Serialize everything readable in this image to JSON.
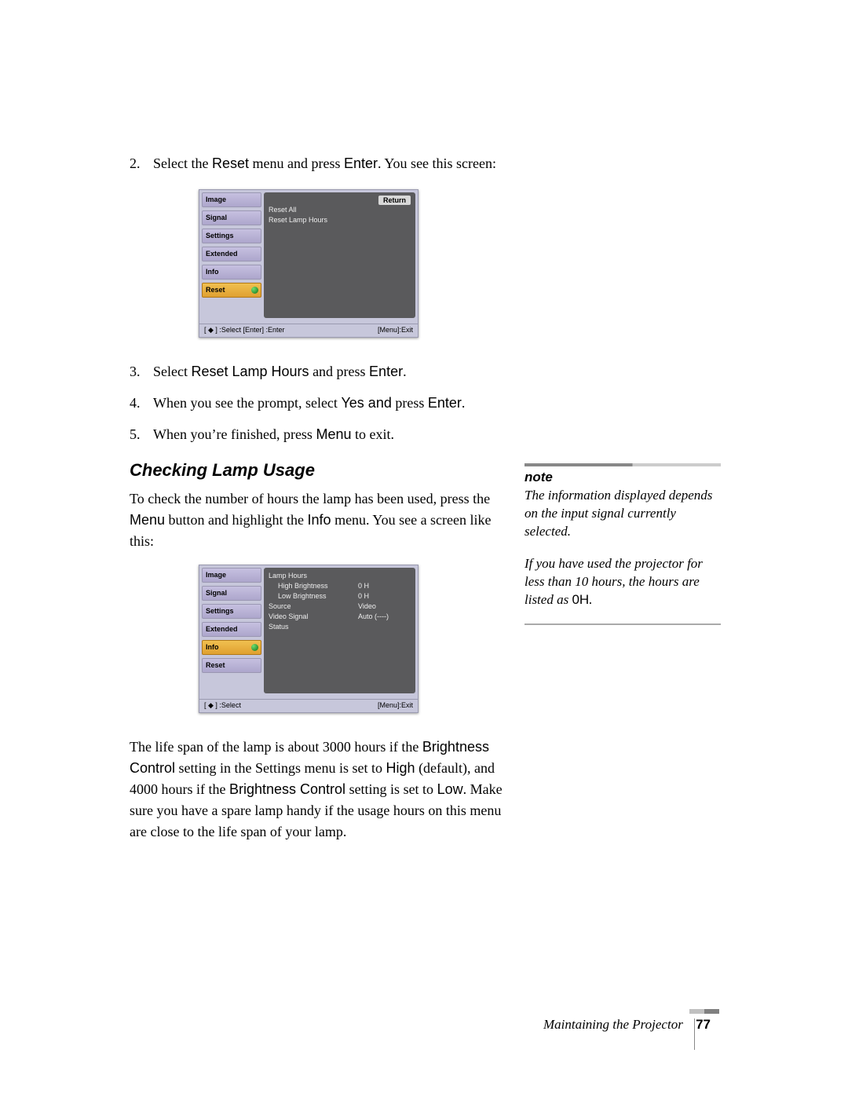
{
  "steps_top": [
    {
      "n": "2.",
      "pre": "Select the ",
      "b1": "Reset",
      "mid": " menu and press ",
      "b2": "Enter",
      "post": ". You see this screen:"
    }
  ],
  "osd1": {
    "tabs": [
      "Image",
      "Signal",
      "Settings",
      "Extended",
      "Info",
      "Reset"
    ],
    "selected_index": 5,
    "return": "Return",
    "items": [
      "Reset All",
      "Reset Lamp Hours"
    ],
    "foot_left": "[ ◆ ] :Select   [Enter] :Enter",
    "foot_right": "[Menu]:Exit"
  },
  "steps_bottom": [
    {
      "n": "3.",
      "parts": [
        "Select ",
        {
          "b": "Reset Lamp Hours"
        },
        " and press ",
        {
          "b": "Enter"
        },
        "."
      ]
    },
    {
      "n": "4.",
      "parts": [
        "When you see the prompt, select ",
        {
          "b": "Yes and"
        },
        " press ",
        {
          "b": "Enter"
        },
        "."
      ]
    },
    {
      "n": "5.",
      "parts": [
        "When you’re finished, press ",
        {
          "b": "Menu"
        },
        " to exit."
      ]
    }
  ],
  "heading": "Checking Lamp Usage",
  "intro": {
    "pre": "To check the number of hours the lamp has been used, press the ",
    "b1": "Menu",
    "mid": " button and highlight the ",
    "b2": "Info",
    "post": " menu. You see a screen like this:"
  },
  "osd2": {
    "tabs": [
      "Image",
      "Signal",
      "Settings",
      "Extended",
      "Info",
      "Reset"
    ],
    "selected_index": 4,
    "rows": [
      {
        "label": "Lamp Hours",
        "value": ""
      },
      {
        "label": "High Brightness",
        "value": "0 H",
        "indent": true
      },
      {
        "label": "Low Brightness",
        "value": "0 H",
        "indent": true
      },
      {
        "label": "Source",
        "value": "Video"
      },
      {
        "label": "Video Signal",
        "value": "Auto (----)"
      },
      {
        "label": "Status",
        "value": ""
      }
    ],
    "foot_left": "[ ◆ ] :Select",
    "foot_right": "[Menu]:Exit"
  },
  "para": {
    "parts": [
      "The life span of the lamp is about 3000 hours if the ",
      {
        "b": "Brightness Control"
      },
      " setting in the Settings menu is set to ",
      {
        "b": "High"
      },
      " (default), and 4000 hours if the ",
      {
        "b": "Brightness Control"
      },
      " setting is set to ",
      {
        "b": "Low"
      },
      ". Make sure you have a spare lamp handy if the usage hours on this menu are close to the life span of your lamp."
    ]
  },
  "note": {
    "title": "note",
    "p1": "The information displayed depends on the input signal currently selected.",
    "p2_pre": "If you have used the projector for less than 10 hours, the hours are listed as ",
    "p2_b": "0H",
    "p2_post": "."
  },
  "footer": {
    "chapter": "Maintaining the Projector",
    "page": "77"
  }
}
